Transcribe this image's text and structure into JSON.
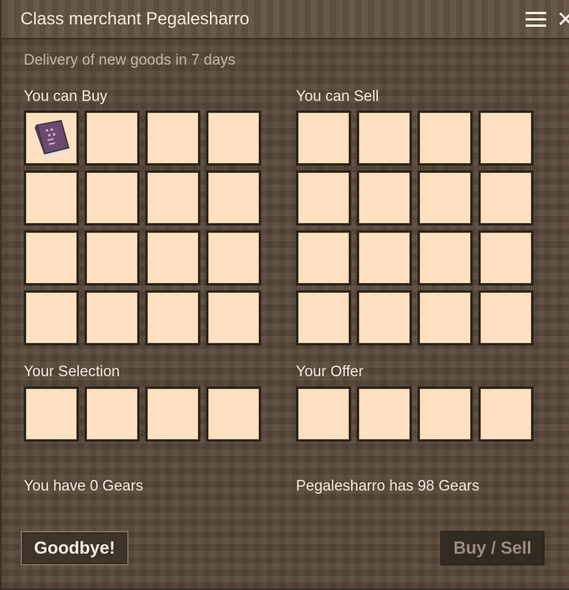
{
  "window": {
    "title": "Class merchant Pegalesharro"
  },
  "delivery_text": "Delivery of new goods in 7 days",
  "sections": {
    "buy_label": "You can Buy",
    "sell_label": "You can Sell",
    "selection_label": "Your Selection",
    "offer_label": "Your Offer"
  },
  "buy_slots": [
    {
      "item": "spellbook-icon"
    },
    {
      "item": ""
    },
    {
      "item": ""
    },
    {
      "item": ""
    },
    {
      "item": ""
    },
    {
      "item": ""
    },
    {
      "item": ""
    },
    {
      "item": ""
    },
    {
      "item": ""
    },
    {
      "item": ""
    },
    {
      "item": ""
    },
    {
      "item": ""
    },
    {
      "item": ""
    },
    {
      "item": ""
    },
    {
      "item": ""
    },
    {
      "item": ""
    }
  ],
  "sell_slot_count": 16,
  "selection_slot_count": 4,
  "offer_slot_count": 4,
  "gears": {
    "player_text": "You have 0 Gears",
    "merchant_text": "Pegalesharro has 98 Gears"
  },
  "buttons": {
    "goodbye": "Goodbye!",
    "buy_sell": "Buy / Sell"
  },
  "colors": {
    "slot_fill": "#fde1c2",
    "panel_bg": "#58493a",
    "text": "#f2eadd"
  }
}
